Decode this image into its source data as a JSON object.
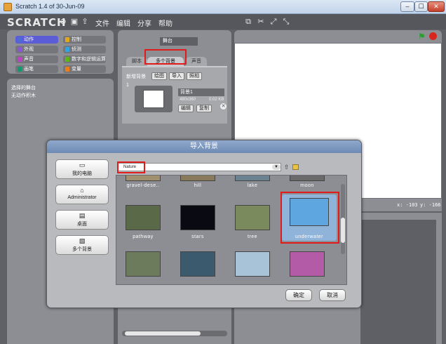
{
  "window": {
    "title": "Scratch 1.4 of 30-Jun-09",
    "min": "–",
    "max": "☐",
    "close": "✕"
  },
  "menubar": {
    "logo": "SCRATCH",
    "items": [
      "文件",
      "编辑",
      "分享",
      "帮助"
    ]
  },
  "palette": {
    "categories": [
      {
        "label": "动作",
        "color": "#4a6cd4",
        "active": true
      },
      {
        "label": "控制",
        "color": "#e1a91a"
      },
      {
        "label": "外观",
        "color": "#8a55d7"
      },
      {
        "label": "侦测",
        "color": "#2ca5e2"
      },
      {
        "label": "声音",
        "color": "#bb42c3"
      },
      {
        "label": "数字和逻辑运算",
        "color": "#5cb712"
      },
      {
        "label": "画笔",
        "color": "#0e9a6c"
      },
      {
        "label": "变量",
        "color": "#ee7d16"
      }
    ],
    "message_line1": "选择的舞台",
    "message_line2": "无动作积木"
  },
  "sprite_panel": {
    "name": "舞台",
    "tabs": [
      "脚本",
      "多个背景",
      "声音"
    ],
    "active_tab": 1,
    "new_bg_label": "新增背景",
    "buttons": [
      "绘图",
      "导入",
      "照相"
    ],
    "background_item": {
      "index": "1",
      "name": "背景1",
      "size": "480x360",
      "bytes": "0.02 KB",
      "edit": "编辑",
      "copy": "复制"
    }
  },
  "stage": {
    "coord_x": "x: -103",
    "coord_y": "y: -166"
  },
  "dialog": {
    "title": "导入背景",
    "side_buttons": [
      {
        "label": "我的电脑",
        "icon": "monitor-icon"
      },
      {
        "label": "Administrator",
        "icon": "house-icon"
      },
      {
        "label": "桌面",
        "icon": "folder-icon"
      },
      {
        "label": "多个背景",
        "icon": "folder-picture-icon"
      }
    ],
    "path": "Nature",
    "files_row0": [
      "gravel-dese..",
      "hill",
      "lake",
      "moon"
    ],
    "files_row1": [
      {
        "label": "pathway",
        "color": "#5a6a48"
      },
      {
        "label": "stars",
        "color": "#0a0a12"
      },
      {
        "label": "tree",
        "color": "#7b8a5c"
      },
      {
        "label": "underwater",
        "color": "#5ea6e0"
      }
    ],
    "files_row2": [
      {
        "color": "#6b7b5c"
      },
      {
        "color": "#3b5a6e"
      },
      {
        "color": "#a8c2d8"
      },
      {
        "color": "#b35ba6"
      }
    ],
    "ok": "确定",
    "cancel": "取消"
  }
}
